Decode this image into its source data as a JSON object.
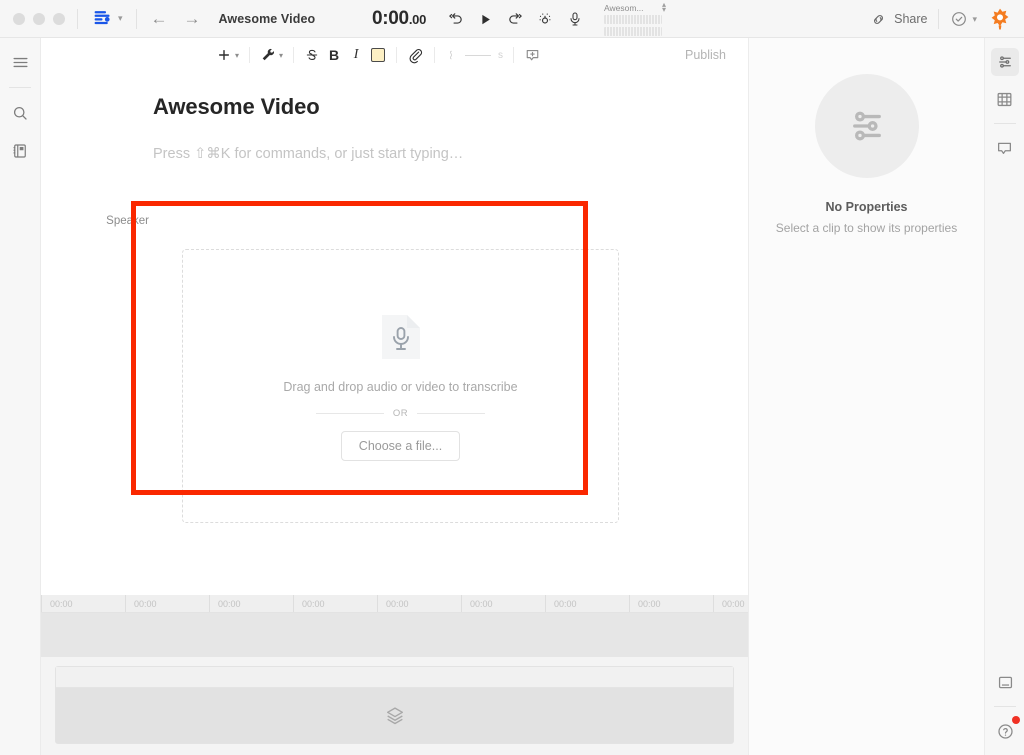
{
  "app": {
    "logo_icon": "descript-logo-icon",
    "accent_blue": "#1d4ed8",
    "accent_orange": "#f57f17",
    "highlight_red": "#fa2800"
  },
  "titlebar": {
    "document_title": "Awesome Video",
    "back_icon": "arrow-left-icon",
    "forward_icon": "arrow-right-icon",
    "logo_chevron_icon": "chevron-down-icon",
    "timecode": "0:00",
    "timecode_fraction": ".00",
    "transport": [
      {
        "name": "undo-icon",
        "label": "Undo"
      },
      {
        "name": "play-icon",
        "label": "Play"
      },
      {
        "name": "redo-icon",
        "label": "Redo"
      },
      {
        "name": "magic-edit-icon",
        "label": "Magic edit"
      },
      {
        "name": "microphone-icon",
        "label": "Record"
      }
    ],
    "track_select": {
      "value": "Awesom...",
      "chevron_icon": "chevron-up-down-icon"
    },
    "share": {
      "label": "Share",
      "icon": "link-icon"
    },
    "status": {
      "icon": "check-circle-icon",
      "chevron_icon": "chevron-down-icon"
    },
    "avatar_icon": "star-burst-icon"
  },
  "left_rail": {
    "items": [
      {
        "name": "sidebar-toggle-icon",
        "label": "Menu"
      },
      {
        "name": "search-icon",
        "label": "Search"
      },
      {
        "name": "notebook-icon",
        "label": "Projects"
      }
    ]
  },
  "right_rail": {
    "items": [
      {
        "name": "properties-icon",
        "label": "Properties",
        "active": true
      },
      {
        "name": "filmstrip-icon",
        "label": "Scenes",
        "active": false
      },
      {
        "name": "comment-icon",
        "label": "Comments",
        "active": false
      }
    ],
    "bottom_items": [
      {
        "name": "panel-toggle-icon",
        "label": "Toggle panel"
      },
      {
        "name": "help-icon",
        "label": "Help"
      }
    ]
  },
  "editor": {
    "toolbar": {
      "insert": {
        "icon": "plus-icon",
        "chevron_icon": "chevron-down-icon"
      },
      "tools": {
        "icon": "wrench-icon",
        "chevron_icon": "chevron-down-icon"
      },
      "strikethrough": {
        "icon": "strikethrough-icon",
        "label": "S"
      },
      "bold": {
        "icon": "bold-icon",
        "label": "B"
      },
      "italic": {
        "icon": "italic-icon",
        "label": "I"
      },
      "highlight": {
        "icon": "highlight-icon",
        "color": "#fdf0c4"
      },
      "attach": {
        "icon": "paperclip-icon"
      },
      "pause": {
        "icon": "pause-marker-icon",
        "unit": "s"
      },
      "comment": {
        "icon": "add-comment-icon"
      }
    },
    "publish_label": "Publish",
    "document_heading": "Awesome Video",
    "speaker_label": "Speaker",
    "paragraph_placeholder": "Press ⇧⌘K for commands, or just start typing…"
  },
  "dropzone": {
    "file_icon": "audio-file-microphone-icon",
    "prompt": "Drag and drop audio or video to transcribe",
    "or_label": "OR",
    "button_label": "Choose a file..."
  },
  "properties_panel": {
    "empty_icon": "sliders-icon",
    "title": "No Properties",
    "subtitle": "Select a clip to show its properties"
  },
  "timeline": {
    "ruler_labels": [
      "00:00",
      "00:00",
      "00:00",
      "00:00",
      "00:00",
      "00:00",
      "00:00",
      "00:00",
      "00:00"
    ],
    "track_icon": "layers-icon"
  }
}
